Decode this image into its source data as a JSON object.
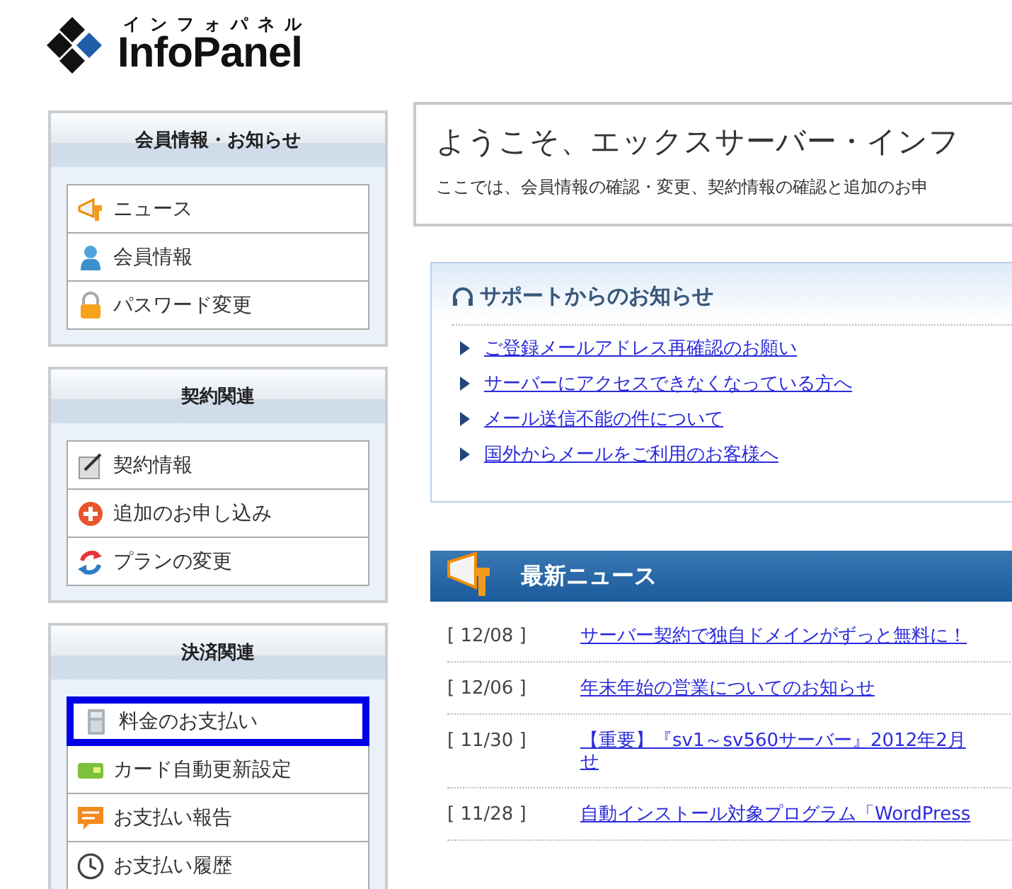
{
  "logo": {
    "kana": "インフォパネル",
    "name": "InfoPanel"
  },
  "sidebar": [
    {
      "title": "会員情報・お知らせ",
      "items": [
        {
          "label": "ニュース",
          "kind": "megaphone",
          "selected": false
        },
        {
          "label": "会員情報",
          "kind": "person",
          "selected": false
        },
        {
          "label": "パスワード変更",
          "kind": "lock",
          "selected": false
        }
      ]
    },
    {
      "title": "契約関連",
      "items": [
        {
          "label": "契約情報",
          "kind": "document",
          "selected": false
        },
        {
          "label": "追加のお申し込み",
          "kind": "plus",
          "selected": false
        },
        {
          "label": "プランの変更",
          "kind": "cycle",
          "selected": false
        }
      ]
    },
    {
      "title": "決済関連",
      "items": [
        {
          "label": "料金のお支払い",
          "kind": "calculator",
          "selected": true
        },
        {
          "label": "カード自動更新設定",
          "kind": "card",
          "selected": false
        },
        {
          "label": "お支払い報告",
          "kind": "speech",
          "selected": false
        },
        {
          "label": "お支払い履歴",
          "kind": "clock",
          "selected": false
        }
      ]
    }
  ],
  "welcome": {
    "title": "ようこそ、エックスサーバー・インフ",
    "text": "ここでは、会員情報の確認・変更、契約情報の確認と追加のお申"
  },
  "support": {
    "title": "サポートからのお知らせ",
    "links": [
      "ご登録メールアドレス再確認のお願い",
      "サーバーにアクセスできなくなっている方へ",
      "メール送信不能の件について",
      "国外からメールをご利用のお客様へ"
    ]
  },
  "news": {
    "title": "最新ニュース",
    "items": [
      {
        "date": "[ 12/08 ]",
        "lines": [
          "サーバー契約で独自ドメインがずっと無料に！"
        ]
      },
      {
        "date": "[ 12/06 ]",
        "lines": [
          "年末年始の営業についてのお知らせ"
        ]
      },
      {
        "date": "[ 11/30 ]",
        "lines": [
          "【重要】『sv1～sv560サーバー』2012年2月",
          "せ"
        ]
      },
      {
        "date": "[ 11/28 ]",
        "lines": [
          "自動インストール対象プログラム「WordPress"
        ]
      }
    ]
  }
}
